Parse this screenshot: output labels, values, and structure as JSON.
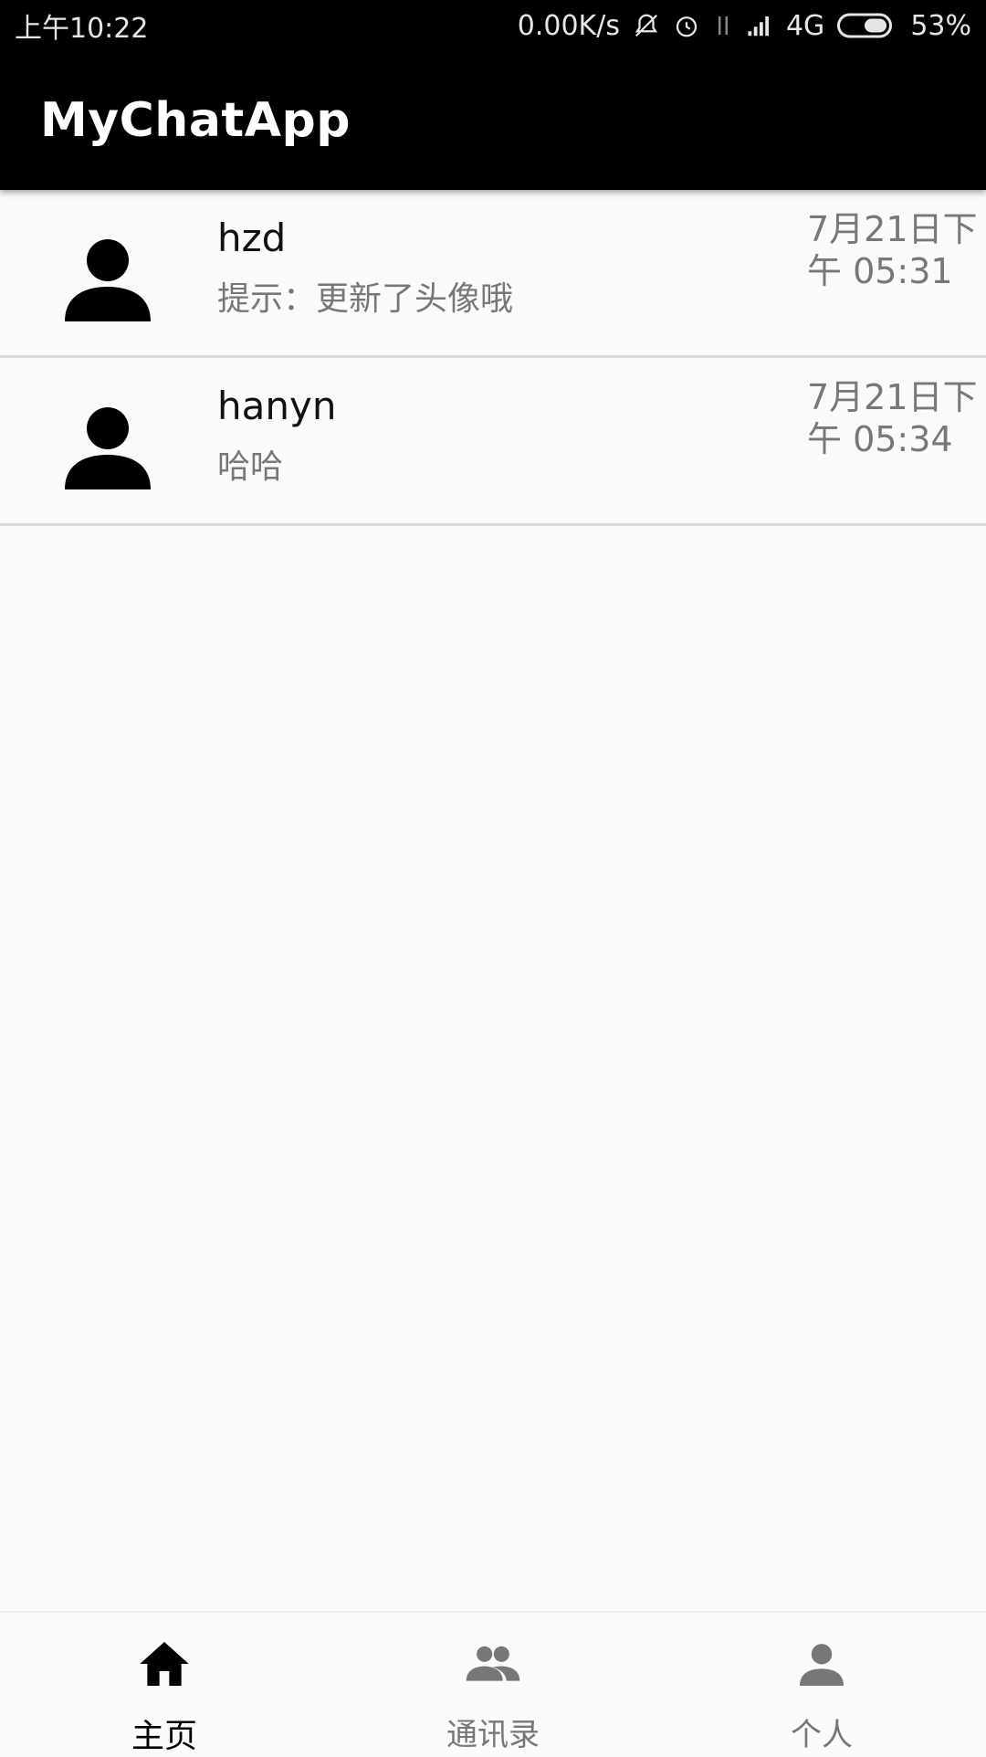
{
  "status_bar": {
    "time": "上午10:22",
    "net_speed": "0.00K/s",
    "network": "4G",
    "battery": "53%",
    "icons": [
      "mute-bell-icon",
      "alarm-icon",
      "data-arrows-icon",
      "signal-icon",
      "battery-icon"
    ]
  },
  "app_bar": {
    "title": "MyChatApp"
  },
  "chats": [
    {
      "name": "hzd",
      "preview": "提示：更新了头像哦",
      "time": "7月21日下午 05:31",
      "avatar_icon": "person-icon"
    },
    {
      "name": "hanyn",
      "preview": "哈哈",
      "time": "7月21日下午 05:34",
      "avatar_icon": "person-icon"
    }
  ],
  "bottom_nav": {
    "items": [
      {
        "label": "主页",
        "icon": "home-icon",
        "active": true
      },
      {
        "label": "通讯录",
        "icon": "contacts-icon",
        "active": false
      },
      {
        "label": "个人",
        "icon": "person-icon",
        "active": false
      }
    ]
  },
  "colors": {
    "app_bar": "#000000",
    "background": "#fafafa",
    "secondary_text": "#777777",
    "divider": "#dcdcdc"
  }
}
